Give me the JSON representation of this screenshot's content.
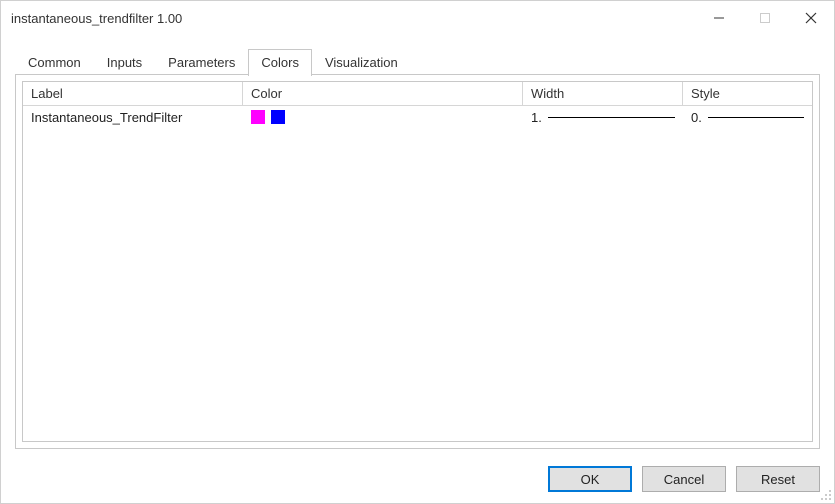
{
  "window": {
    "title": "instantaneous_trendfilter 1.00"
  },
  "tabs": [
    {
      "label": "Common"
    },
    {
      "label": "Inputs"
    },
    {
      "label": "Parameters"
    },
    {
      "label": "Colors"
    },
    {
      "label": "Visualization"
    }
  ],
  "active_tab": "Colors",
  "grid": {
    "headers": {
      "label": "Label",
      "color": "Color",
      "width": "Width",
      "style": "Style"
    },
    "rows": [
      {
        "label": "Instantaneous_TrendFilter",
        "colors": [
          "#ff00ff",
          "#0000ff"
        ],
        "width_text": "1.",
        "style_text": "0."
      }
    ]
  },
  "buttons": {
    "ok": "OK",
    "cancel": "Cancel",
    "reset": "Reset"
  }
}
